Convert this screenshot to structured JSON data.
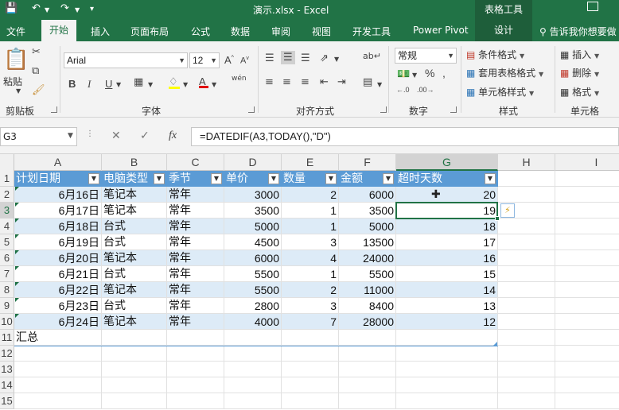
{
  "titlebar": {
    "title": "演示.xlsx  -  Excel",
    "table_tools": "表格工具",
    "icons": [
      "save-icon",
      "undo-icon",
      "redo-icon",
      "customize-icon",
      "restore-window-icon"
    ]
  },
  "tabs": [
    {
      "id": "file",
      "label": "文件"
    },
    {
      "id": "home",
      "label": "开始",
      "active": true
    },
    {
      "id": "insert",
      "label": "插入"
    },
    {
      "id": "layout",
      "label": "页面布局"
    },
    {
      "id": "formulas",
      "label": "公式"
    },
    {
      "id": "data",
      "label": "数据"
    },
    {
      "id": "review",
      "label": "审阅"
    },
    {
      "id": "view",
      "label": "视图"
    },
    {
      "id": "developer",
      "label": "开发工具"
    },
    {
      "id": "powerpivot",
      "label": "Power Pivot"
    },
    {
      "id": "design",
      "label": "设计"
    }
  ],
  "tell_me": "告诉我你想要做",
  "ribbon": {
    "clipboard": {
      "label": "剪贴板",
      "paste": "粘贴"
    },
    "font": {
      "label": "字体",
      "font_name": "Arial",
      "font_size": "12",
      "bold": "B",
      "italic": "I",
      "underline": "U",
      "wen": "wén"
    },
    "alignment": {
      "label": "对齐方式"
    },
    "number": {
      "label": "数字",
      "format": "常规"
    },
    "styles": {
      "label": "样式",
      "conditional": "条件格式",
      "table_format": "套用表格格式",
      "cell_styles": "单元格样式"
    },
    "cells": {
      "label": "单元格",
      "insert": "插入",
      "delete": "删除",
      "format": "格式"
    }
  },
  "formula_bar": {
    "name_box": "G3",
    "formula": "=DATEDIF(A3,TODAY(),\"D\")",
    "fx": "fx",
    "cancel": "✕",
    "enter": "✓"
  },
  "columns": [
    "A",
    "B",
    "C",
    "D",
    "E",
    "F",
    "G",
    "H",
    "I"
  ],
  "rows": [
    "1",
    "2",
    "3",
    "4",
    "5",
    "6",
    "7",
    "8",
    "9",
    "10",
    "11",
    "12",
    "13",
    "14",
    "15"
  ],
  "table": {
    "headers": [
      "计划日期",
      "电脑类型",
      "季节",
      "单价",
      "数量",
      "金额",
      "超时天数"
    ],
    "data": [
      [
        "6月16日",
        "笔记本",
        "常年",
        "3000",
        "2",
        "6000",
        "20"
      ],
      [
        "6月17日",
        "笔记本",
        "常年",
        "3500",
        "1",
        "3500",
        "19"
      ],
      [
        "6月18日",
        "台式",
        "常年",
        "5000",
        "1",
        "5000",
        "18"
      ],
      [
        "6月19日",
        "台式",
        "常年",
        "4500",
        "3",
        "13500",
        "17"
      ],
      [
        "6月20日",
        "笔记本",
        "常年",
        "6000",
        "4",
        "24000",
        "16"
      ],
      [
        "6月21日",
        "台式",
        "常年",
        "5500",
        "1",
        "5500",
        "15"
      ],
      [
        "6月22日",
        "笔记本",
        "常年",
        "5500",
        "2",
        "11000",
        "14"
      ],
      [
        "6月23日",
        "台式",
        "常年",
        "2800",
        "3",
        "8400",
        "13"
      ],
      [
        "6月24日",
        "笔记本",
        "常年",
        "4000",
        "7",
        "28000",
        "12"
      ]
    ],
    "total_label": "汇总"
  },
  "selection": {
    "column": "G",
    "row": "3"
  },
  "colors": {
    "excel_green": "#217346",
    "table_header": "#5b9bd5",
    "table_band": "#ddebf7"
  }
}
